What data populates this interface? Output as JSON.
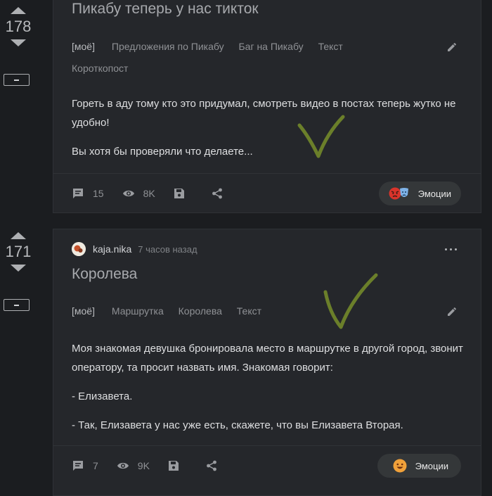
{
  "post1": {
    "score": "178",
    "title": "Пикабу теперь у нас тикток",
    "tags": [
      "[моё]",
      "Предложения по Пикабу",
      "Баг на Пикабу",
      "Текст",
      "Короткопост"
    ],
    "body": [
      "Гореть в аду тому кто это придумал, смотреть видео в постах теперь жутко не удобно!",
      "Вы хотя бы проверяли что делаете..."
    ],
    "comments": "15",
    "views": "8K",
    "emotions_label": "Эмоции"
  },
  "post2": {
    "score": "171",
    "author": "kaja.nika",
    "time": "7 часов назад",
    "title": "Королева",
    "tags": [
      "[моё]",
      "Маршрутка",
      "Королева",
      "Текст"
    ],
    "body": [
      "Моя знакомая девушка бронировала место в маршрутке в другой город, звонит оператору, та просит назвать имя. Знакомая говорит:",
      "- Елизавета.",
      "- Так, Елизавета у нас уже есть, скажете, что вы Елизавета Вторая."
    ],
    "comments": "7",
    "views": "9K",
    "emotions_label": "Эмоции"
  },
  "colors": {
    "background": "#1b1d20",
    "card": "#25272b",
    "checkmark": "#6b7f2a"
  },
  "icons": [
    "arrow-up-icon",
    "arrow-down-icon",
    "collapse-icon",
    "pencil-icon",
    "comment-icon",
    "eye-icon",
    "save-icon",
    "share-icon",
    "more-icon",
    "emotion-angry-icon",
    "emotion-masks-icon",
    "emotion-smile-icon"
  ]
}
